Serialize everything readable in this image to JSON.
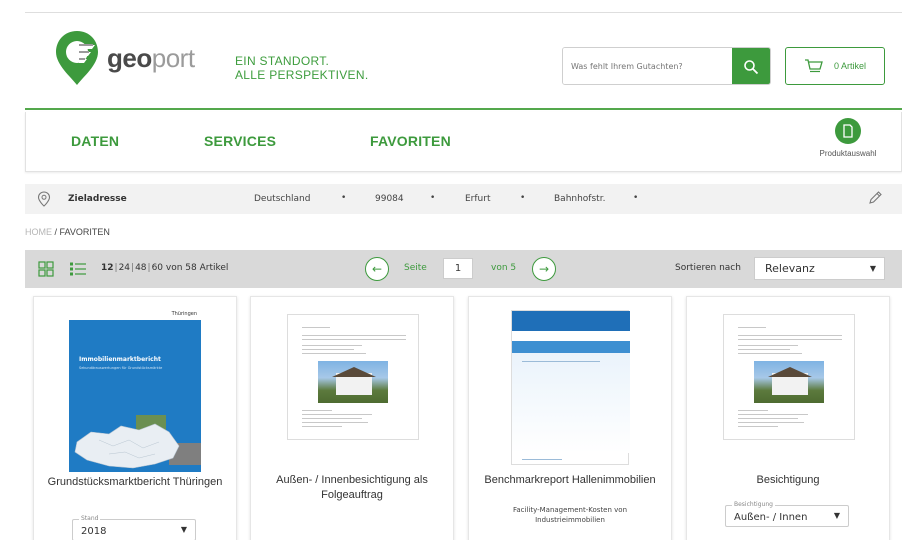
{
  "brand": {
    "logo_bold": "geo",
    "logo_light": "port",
    "slogan_line1": "EIN STANDORT.",
    "slogan_line2": "ALLE PERSPEKTIVEN.",
    "accent": "#3d9a3d"
  },
  "header": {
    "search_placeholder": "Was fehlt Ihrem Gutachten?",
    "cart_label": "0 Artikel"
  },
  "nav": {
    "items": [
      {
        "label": "DATEN"
      },
      {
        "label": "SERVICES"
      },
      {
        "label": "FAVORITEN"
      }
    ],
    "product_label": "Produktauswahl"
  },
  "address": {
    "label": "Zieladresse",
    "country": "Deutschland",
    "zip": "99084",
    "city": "Erfurt",
    "street": "Bahnhofstr.",
    "separator": "•"
  },
  "breadcrumb": {
    "home": "HOME",
    "sep": " / ",
    "current": "FAVORITEN"
  },
  "toolbar": {
    "per_page": [
      "12",
      "24",
      "48",
      "60"
    ],
    "count_text": "von 58 Artikel",
    "page_label": "Seite",
    "page_value": "1",
    "page_total": "von 5",
    "sort_label": "Sortieren nach",
    "sort_value": "Relevanz"
  },
  "cards": [
    {
      "title": "Grundstücksmarktbericht Thüringen",
      "select_legend": "Stand",
      "select_value": "2018",
      "cover_heading": "Immobilienmarktbericht",
      "cover_sub": "Sekundärauswertungen für Grundstücksmärkte",
      "cover_brand": "Thüringen"
    },
    {
      "title": "Außen- / Innenbesichtigung als Folgeauftrag"
    },
    {
      "title": "Benchmarkreport Hallenimmobilien",
      "subtitle": "Facility-Management-Kosten von Industrieimmobilien"
    },
    {
      "title": "Besichtigung",
      "select_legend": "Besichtigung",
      "select_value": "Außen- / Innen"
    }
  ]
}
